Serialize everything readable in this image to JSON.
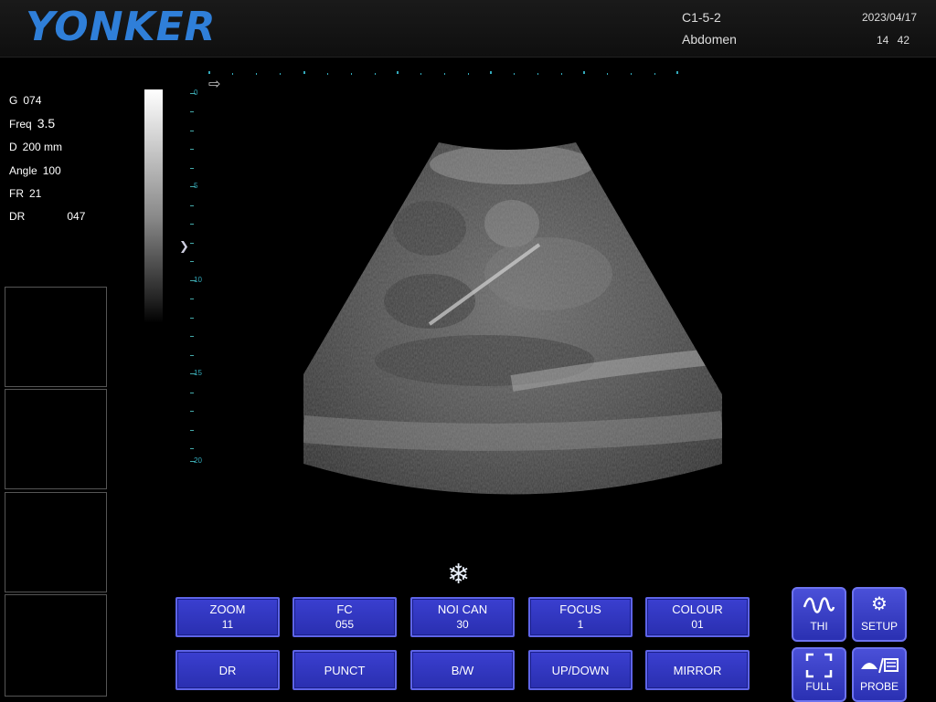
{
  "header": {
    "brand": "YONKER",
    "probe": "C1-5-2",
    "preset": "Abdomen",
    "date": "2023/04/17",
    "time": "14 42"
  },
  "params": [
    {
      "label": "G",
      "value": "074"
    },
    {
      "label": "Freq",
      "value": "3.5"
    },
    {
      "label": "D",
      "value": "200 mm"
    },
    {
      "label": "Angle",
      "value": "100"
    },
    {
      "label": "FR",
      "value": "21"
    },
    {
      "label": "DR",
      "value": "047"
    }
  ],
  "depth_labels": [
    "0",
    "5",
    "10",
    "15",
    "20"
  ],
  "controls_row1": [
    {
      "label": "ZOOM",
      "value": "11"
    },
    {
      "label": "FC",
      "value": "055"
    },
    {
      "label": "NOI CAN",
      "value": "30"
    },
    {
      "label": "FOCUS",
      "value": "1"
    },
    {
      "label": "COLOUR",
      "value": "01"
    }
  ],
  "controls_row2": [
    "DR",
    "PUNCT",
    "B/W",
    "UP/DOWN",
    "MIRROR"
  ],
  "side_buttons": {
    "thi": {
      "label": "THI",
      "icon": "thi-wave-icon"
    },
    "setup": {
      "label": "SETUP",
      "icon": "gear-icon"
    },
    "full": {
      "label": "FULL",
      "icon": "fullscreen-icon"
    },
    "probe": {
      "label": "PROBE",
      "icon": "probe-icon"
    }
  },
  "colors": {
    "brand": "#2f7fd9",
    "button": "#3a3fd0",
    "accent": "#3ab"
  }
}
